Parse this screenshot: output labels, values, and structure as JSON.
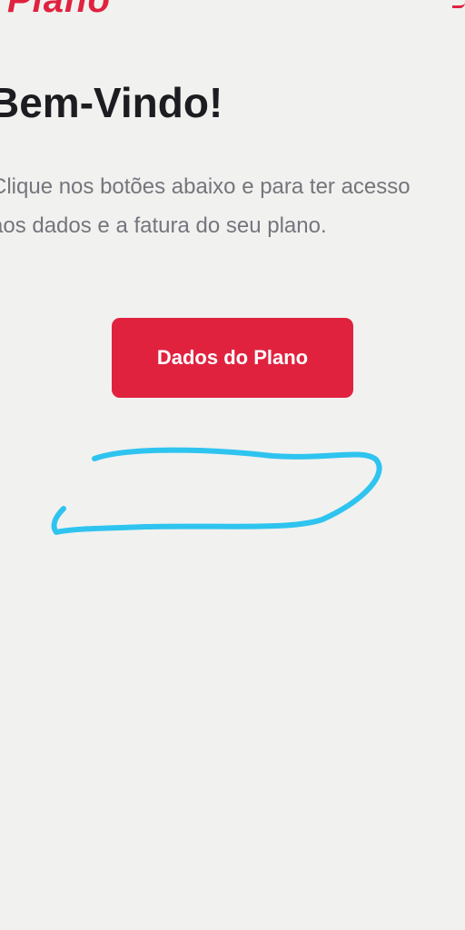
{
  "brand": {
    "logo_text": "Plano",
    "color": "#e0223f"
  },
  "welcome": {
    "title": "Bem-Vindo!",
    "subtitle_line1": "Clique nos botões abaixo e para ter acesso",
    "subtitle_line2": "aos dados e a fatura do seu plano."
  },
  "actions": {
    "plan_button_label": "Dados do Plano"
  },
  "colors": {
    "background": "#f1f1ef",
    "accent": "#e0223f",
    "title": "#1d1d21",
    "body_text": "#75757d",
    "annotation": "#2ec4ef"
  },
  "annotation": {
    "icon": "freehand-scribble"
  }
}
